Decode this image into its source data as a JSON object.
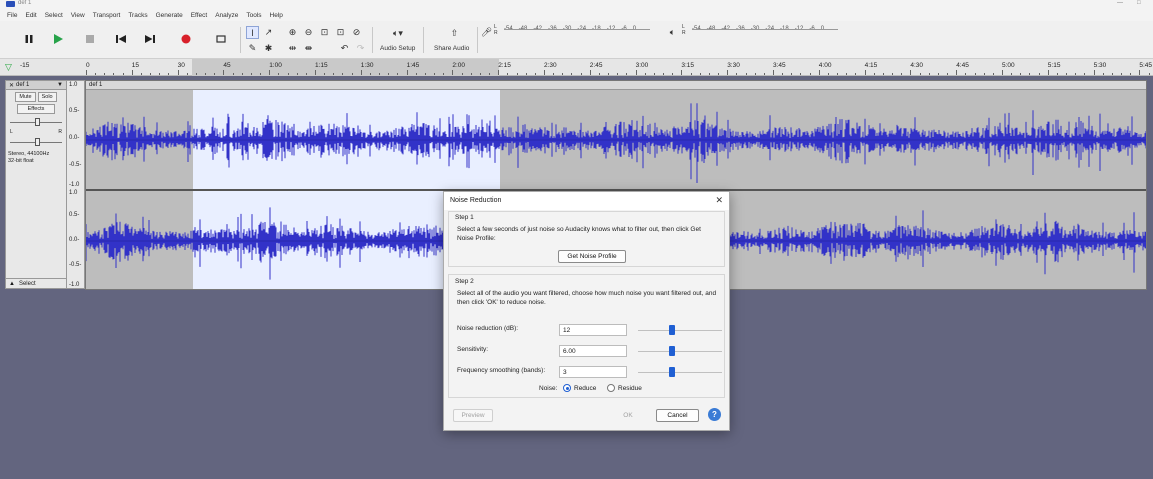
{
  "window": {
    "title": "def 1",
    "minimize": "—",
    "maximize": "□"
  },
  "menu": [
    "File",
    "Edit",
    "Select",
    "View",
    "Transport",
    "Tracks",
    "Generate",
    "Effect",
    "Analyze",
    "Tools",
    "Help"
  ],
  "toolbar": {
    "audio_setup": "Audio Setup",
    "share_audio": "Share Audio",
    "meter_ticks": [
      "-54",
      "-48",
      "-42",
      "-36",
      "-30",
      "-24",
      "-18",
      "-12",
      "-6",
      "0"
    ],
    "meter_lr_top": "L",
    "meter_lr_bottom": "R"
  },
  "timeline": {
    "lead_label": "-15",
    "labels": [
      "0",
      "15",
      "30",
      "45",
      "1:00",
      "1:15",
      "1:30",
      "1:45",
      "2:00",
      "2:15",
      "2:30",
      "2:45",
      "3:00",
      "3:15",
      "3:30",
      "3:45",
      "4:00",
      "4:15",
      "4:30",
      "4:45",
      "5:00",
      "5:15",
      "5:30",
      "5:45"
    ]
  },
  "track": {
    "name": "def 1",
    "clip_name": "def 1",
    "mute": "Mute",
    "solo": "Solo",
    "effects": "Effects",
    "pan_left": "L",
    "pan_right": "R",
    "info_line1": "Stereo, 44100Hz",
    "info_line2": "32-bit float",
    "select": "Select",
    "scale_top": [
      "1.0",
      "0.5-",
      "0.0-",
      "-0.5-",
      "-1.0"
    ],
    "scale_bottom": [
      "1.0",
      "0.5-",
      "0.0-",
      "-0.5-",
      "-1.0"
    ]
  },
  "dialog": {
    "title": "Noise Reduction",
    "step1_label": "Step 1",
    "step1_text": "Select a few seconds of just noise so Audacity knows what to filter out, then click Get Noise Profile:",
    "get_profile": "Get Noise Profile",
    "step2_label": "Step 2",
    "step2_text": "Select all of the audio you want filtered, choose how much noise you want filtered out, and then click 'OK' to reduce noise.",
    "fields": [
      {
        "label": "Noise reduction (dB):",
        "value": "12",
        "slider_fraction": 0.4
      },
      {
        "label": "Sensitivity:",
        "value": "6.00",
        "slider_fraction": 0.4
      },
      {
        "label": "Frequency smoothing (bands):",
        "value": "3",
        "slider_fraction": 0.4
      }
    ],
    "noise_label": "Noise:",
    "reduce": "Reduce",
    "residue": "Residue",
    "preview": "Preview",
    "ok": "OK",
    "cancel": "Cancel",
    "help": "?"
  },
  "colors": {
    "waveform": "#3232c8",
    "selection": "#e9efff",
    "accent": "#1f5fd3",
    "background": "#63657f"
  }
}
